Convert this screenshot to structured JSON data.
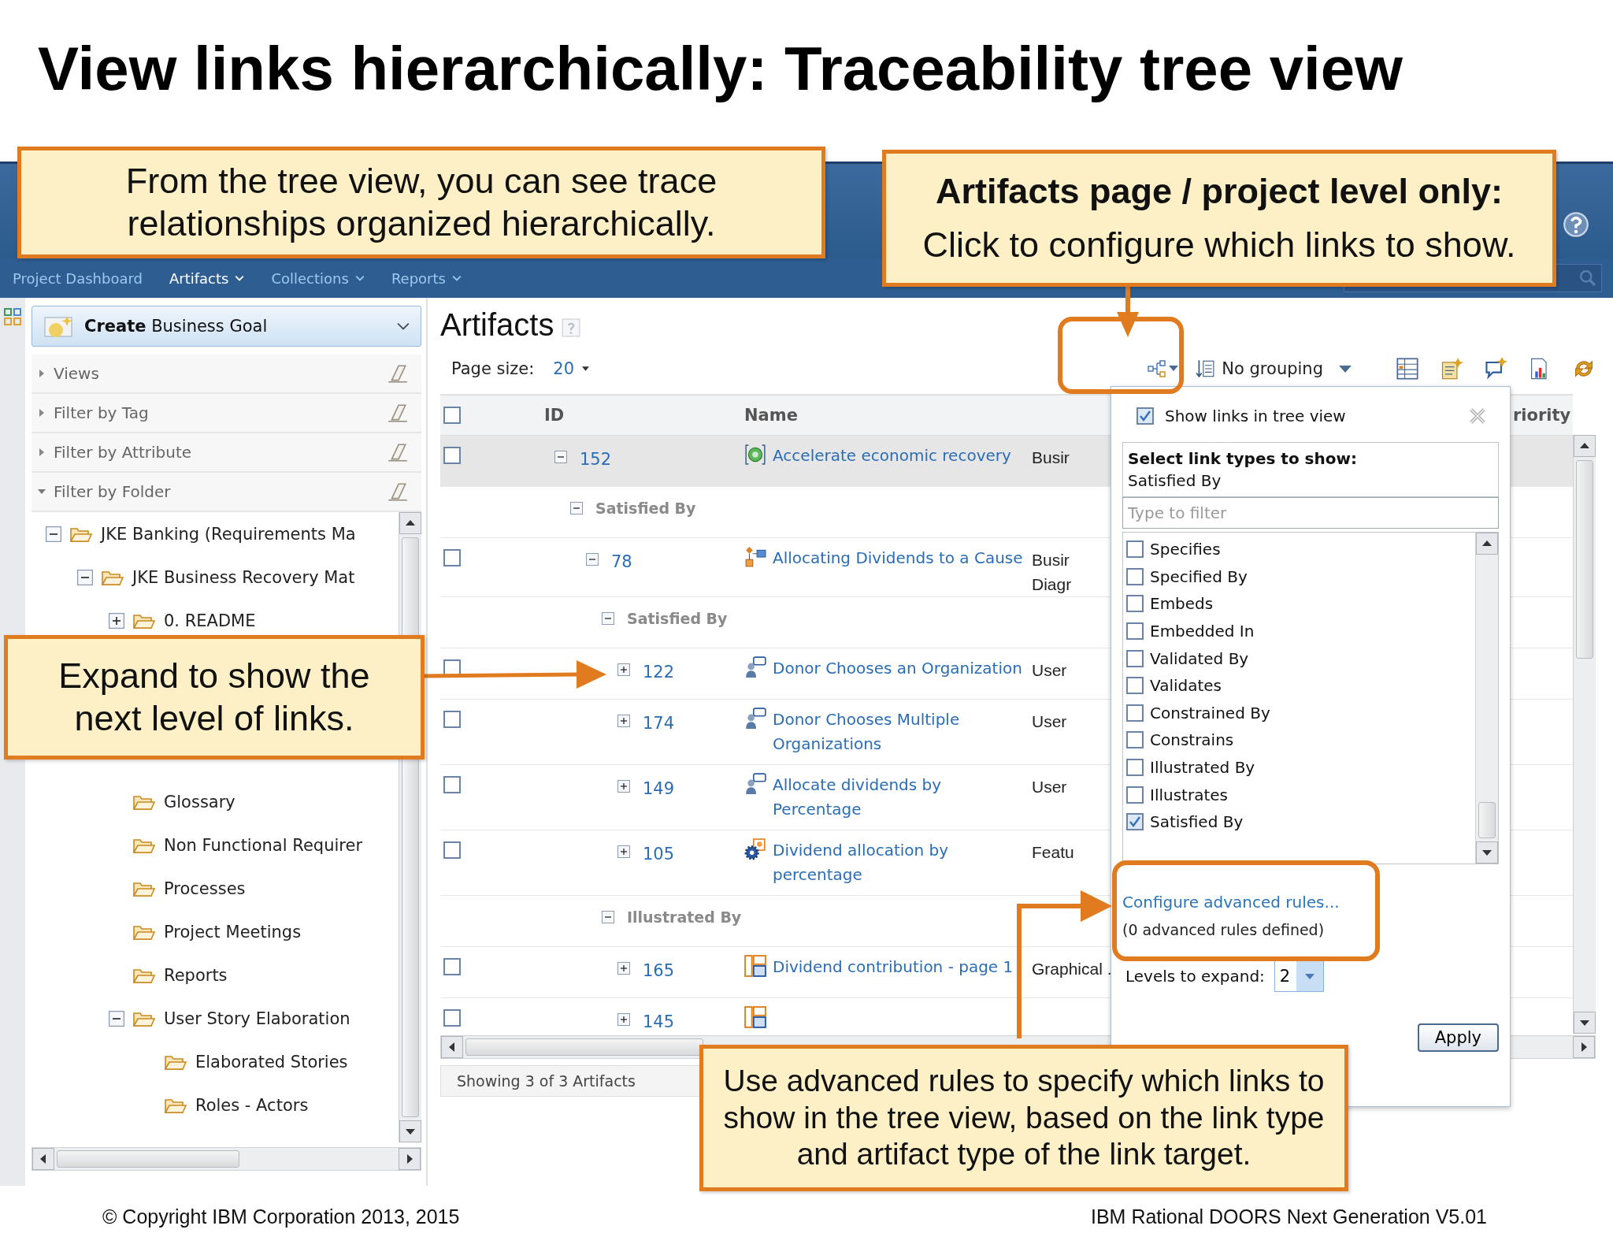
{
  "slide": {
    "title": "View links hierarchically: Traceability tree view",
    "copyright": "© Copyright IBM Corporation 2013, 2015",
    "product": "IBM Rational DOORS Next Generation V5.01"
  },
  "callouts": [
    {
      "text": "From the tree view, you can see trace relationships organized hierarchically."
    },
    {
      "heading": "Artifacts page / project level only:",
      "text": "Click to configure which links to show."
    },
    {
      "text": "Expand to show the next level of links."
    },
    {
      "text": "Use advanced rules to specify which links to show in the tree view, based on the link type and artifact type of the link target."
    }
  ],
  "nav": [
    {
      "label": "Project Dashboard",
      "menu": false,
      "selected": false
    },
    {
      "label": "Artifacts",
      "menu": true,
      "selected": true
    },
    {
      "label": "Collections",
      "menu": true,
      "selected": false
    },
    {
      "label": "Reports",
      "menu": true,
      "selected": false
    }
  ],
  "sidebar": {
    "create_button": "**Create** Business Goal",
    "sections": [
      {
        "label": "Views",
        "expanded": false
      },
      {
        "label": "Filter by Tag",
        "expanded": false
      },
      {
        "label": "Filter by Attribute",
        "expanded": false
      },
      {
        "label": "Filter by Folder",
        "expanded": true
      }
    ],
    "folders": [
      {
        "label": "JKE Banking (Requirements Ma",
        "expanded": true,
        "children": [
          {
            "label": "JKE Business Recovery Mat",
            "expanded": true,
            "children": [
              {
                "label": "0. README",
                "expanded": false
              },
              {
                "label": "Glossary"
              },
              {
                "label": "Non Functional Requirer"
              },
              {
                "label": "Processes"
              },
              {
                "label": "Project Meetings"
              },
              {
                "label": "Reports"
              },
              {
                "label": "User Story Elaboration",
                "expanded": true,
                "children": [
                  {
                    "label": "Elaborated Stories"
                  },
                  {
                    "label": "Roles - Actors"
                  }
                ]
              }
            ]
          }
        ]
      }
    ]
  },
  "artifacts": {
    "heading": "Artifacts",
    "page_size_label": "Page size:",
    "page_size": "20",
    "grouping": "No grouping",
    "select_all_checked": false,
    "columns": [
      "ID",
      "Name",
      "riority"
    ],
    "rows": [
      {
        "kind": "goal",
        "id": "152",
        "name": "Accelerate economic recovery",
        "type": "Busir",
        "checked": false,
        "selected": true,
        "expanded": true,
        "children": [
          {
            "kind": "group",
            "label": "Satisfied By",
            "expanded": true,
            "children": [
              {
                "kind": "diagram",
                "id": "78",
                "name": "Allocating Dividends to a Cause",
                "type": "Busir\nDiagr",
                "checked": false,
                "selected": false,
                "expanded": true,
                "children": [
                  {
                    "kind": "group",
                    "label": "Satisfied By",
                    "expanded": true,
                    "children": [
                      {
                        "kind": "story",
                        "id": "122",
                        "name": "Donor Chooses an Organization",
                        "type": "User",
                        "checked": false,
                        "selected": false,
                        "expanded": false
                      },
                      {
                        "kind": "story",
                        "id": "174",
                        "name": "Donor Chooses Multiple Organizations",
                        "type": "User",
                        "checked": false,
                        "selected": false,
                        "expanded": false
                      },
                      {
                        "kind": "story",
                        "id": "149",
                        "name": "Allocate dividends by Percentage",
                        "type": "User",
                        "checked": false,
                        "selected": false,
                        "expanded": false
                      },
                      {
                        "kind": "feature",
                        "id": "105",
                        "name": "Dividend allocation by percentage",
                        "type": "Featu",
                        "checked": false,
                        "selected": false,
                        "expanded": false
                      }
                    ]
                  },
                  {
                    "kind": "group",
                    "label": "Illustrated By",
                    "expanded": true,
                    "children": [
                      {
                        "kind": "graphic",
                        "id": "165",
                        "name": "Dividend contribution - page 1",
                        "type": "Graphical .",
                        "checked": false,
                        "selected": false,
                        "expanded": false
                      },
                      {
                        "kind": "graphic",
                        "id": "145",
                        "checked": false,
                        "selected": false,
                        "expanded": false
                      }
                    ]
                  }
                ]
              }
            ]
          }
        ]
      }
    ],
    "status": "Showing 3 of 3 Artifacts"
  },
  "link_popup": {
    "show_in_tree": {
      "label": "Show links in tree view",
      "checked": true
    },
    "select_heading": "Select link types to show:",
    "selected_summary": "Satisfied By",
    "filter_placeholder": "Type to filter",
    "link_types": [
      {
        "label": "Specifies",
        "checked": false
      },
      {
        "label": "Specified By",
        "checked": false
      },
      {
        "label": "Embeds",
        "checked": false
      },
      {
        "label": "Embedded In",
        "checked": false
      },
      {
        "label": "Validated By",
        "checked": false
      },
      {
        "label": "Validates",
        "checked": false
      },
      {
        "label": "Constrained By",
        "checked": false
      },
      {
        "label": "Constrains",
        "checked": false
      },
      {
        "label": "Illustrated By",
        "checked": false
      },
      {
        "label": "Illustrates",
        "checked": false
      },
      {
        "label": "Satisfied By",
        "checked": true
      }
    ],
    "advanced_link": "Configure advanced rules...",
    "advanced_note": "(0 advanced rules defined)",
    "levels_label": "Levels to expand:",
    "levels": "2",
    "apply": "Apply"
  }
}
